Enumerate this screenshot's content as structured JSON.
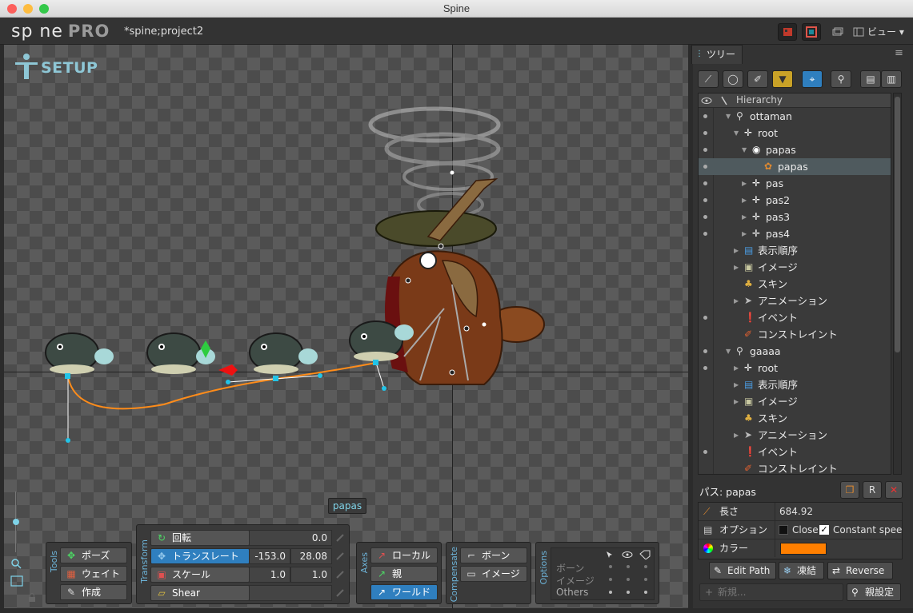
{
  "window": {
    "title": "Spine"
  },
  "app": {
    "logo": "sp ne",
    "logo_pro": "PRO",
    "project": "*spine;project2",
    "view_menu": "ビュー"
  },
  "viewport": {
    "mode_label": "SETUP",
    "tooltip": "papas",
    "tools": {
      "group_label": "Tools",
      "pose": "ポーズ",
      "weight": "ウェイト",
      "create": "作成"
    },
    "transform": {
      "group_label": "Transform",
      "rotate": {
        "label": "回転",
        "value": "0.0"
      },
      "translate": {
        "label": "トランスレート",
        "x": "-153.0",
        "y": "28.08"
      },
      "scale": {
        "label": "スケール",
        "x": "1.0",
        "y": "1.0"
      },
      "shear": {
        "label": "Shear"
      }
    },
    "axes": {
      "group_label": "Axes",
      "local": "ローカル",
      "parent": "親",
      "world": "ワールド"
    },
    "compensate": {
      "group_label": "Compensate",
      "bone": "ボーン",
      "image": "イメージ"
    },
    "options": {
      "group_label": "Options",
      "bone": "ボーン",
      "image": "イメージ",
      "others": "Others"
    }
  },
  "tree_panel": {
    "tab": "ツリー",
    "header": "Hierarchy",
    "rows": [
      {
        "label": "ottaman",
        "icon": "skeleton-icon",
        "arrow": "▼",
        "eye": true
      },
      {
        "label": "root",
        "icon": "bone-icon",
        "arrow": "▼",
        "eye": true
      },
      {
        "label": "papas",
        "icon": "slot-icon",
        "arrow": "▼",
        "eye": true
      },
      {
        "label": "papas",
        "icon": "path-icon",
        "arrow": "",
        "eye": true,
        "selected": true
      },
      {
        "label": "pas",
        "icon": "bone-icon",
        "arrow": "▶",
        "eye": true
      },
      {
        "label": "pas2",
        "icon": "bone-icon",
        "arrow": "▶",
        "eye": true
      },
      {
        "label": "pas3",
        "icon": "bone-icon",
        "arrow": "▶",
        "eye": true
      },
      {
        "label": "pas4",
        "icon": "bone-icon",
        "arrow": "▶",
        "eye": true
      },
      {
        "label": "表示順序",
        "icon": "draw-order-icon",
        "arrow": "▶",
        "eye": false
      },
      {
        "label": "イメージ",
        "icon": "folder-icon",
        "arrow": "▶",
        "eye": false
      },
      {
        "label": "スキン",
        "icon": "skins-icon",
        "arrow": "",
        "eye": false
      },
      {
        "label": "アニメーション",
        "icon": "animation-icon",
        "arrow": "▶",
        "eye": false
      },
      {
        "label": "イベント",
        "icon": "event-icon",
        "arrow": "",
        "eye": true
      },
      {
        "label": "コンストレイント",
        "icon": "constraint-icon",
        "arrow": "",
        "eye": false
      },
      {
        "label": "gaaaa",
        "icon": "skeleton-icon",
        "arrow": "▼",
        "eye": true
      },
      {
        "label": "root",
        "icon": "bone-icon",
        "arrow": "▶",
        "eye": true
      },
      {
        "label": "表示順序",
        "icon": "draw-order-icon",
        "arrow": "▶",
        "eye": false
      },
      {
        "label": "イメージ",
        "icon": "folder-icon",
        "arrow": "▶",
        "eye": false
      },
      {
        "label": "スキン",
        "icon": "skins-icon",
        "arrow": "",
        "eye": false
      },
      {
        "label": "アニメーション",
        "icon": "animation-icon",
        "arrow": "▶",
        "eye": false
      },
      {
        "label": "イベント",
        "icon": "event-icon",
        "arrow": "",
        "eye": true
      },
      {
        "label": "コンストレイント",
        "icon": "constraint-icon",
        "arrow": "",
        "eye": false
      }
    ]
  },
  "properties": {
    "title": "パス: papas",
    "length": {
      "label": "長さ",
      "value": "684.92"
    },
    "options": {
      "label": "オプション",
      "close": "Close",
      "constant_speed": "Constant speed"
    },
    "color": {
      "label": "カラー",
      "value": "#ff7f00"
    },
    "edit_path": "Edit Path",
    "freeze": "凍結",
    "reverse": "Reverse",
    "new_placeholder": "新規...",
    "set_parent": "親設定"
  },
  "colors": {
    "accent": "#2f7fbf",
    "path": "#ff8c1a",
    "selection": "#4f5a5e"
  }
}
